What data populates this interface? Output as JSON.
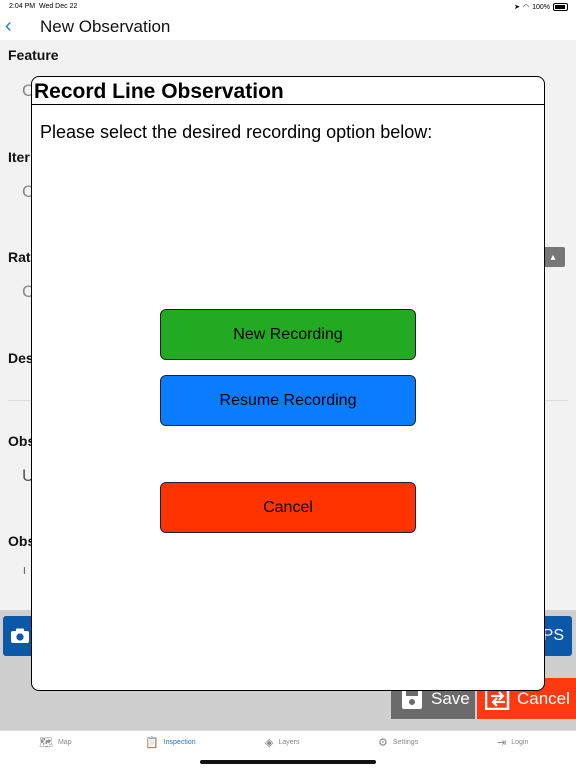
{
  "status_bar": {
    "time": "2:04 PM",
    "date": "Wed Dec 22",
    "battery": "100%"
  },
  "nav": {
    "back_icon": "chevron-left-icon",
    "title": "New Observation"
  },
  "form": {
    "feature_label": "Feature",
    "item_label": "Iter",
    "rating_label": "Rat",
    "description_label": "Des",
    "obs1_label": "Obs",
    "obs2_label": "Obs",
    "radio_fragment_1": "C",
    "radio_fragment_2": "C",
    "radio_fragment_3": "C",
    "obs1_value_fragment": "U",
    "obs2_value_fragment": "I",
    "gps_label_fragment": "PS"
  },
  "actions": {
    "save_label": "Save",
    "cancel_label": "Cancel"
  },
  "tabs": [
    {
      "label": "Map",
      "icon": "map-icon"
    },
    {
      "label": "Inspection",
      "icon": "clipboard-icon",
      "active": true
    },
    {
      "label": "Layers",
      "icon": "layers-icon"
    },
    {
      "label": "Settings",
      "icon": "gear-icon"
    },
    {
      "label": "Login",
      "icon": "login-icon"
    }
  ],
  "modal": {
    "title": "Record Line Observation",
    "message": "Please select the desired recording option below:",
    "new_recording": "New Recording",
    "resume_recording": "Resume Recording",
    "cancel": "Cancel"
  },
  "colors": {
    "new_recording": "#22aa22",
    "resume_recording": "#0a7cff",
    "cancel": "#ff3300",
    "accent": "#1e78e6"
  }
}
